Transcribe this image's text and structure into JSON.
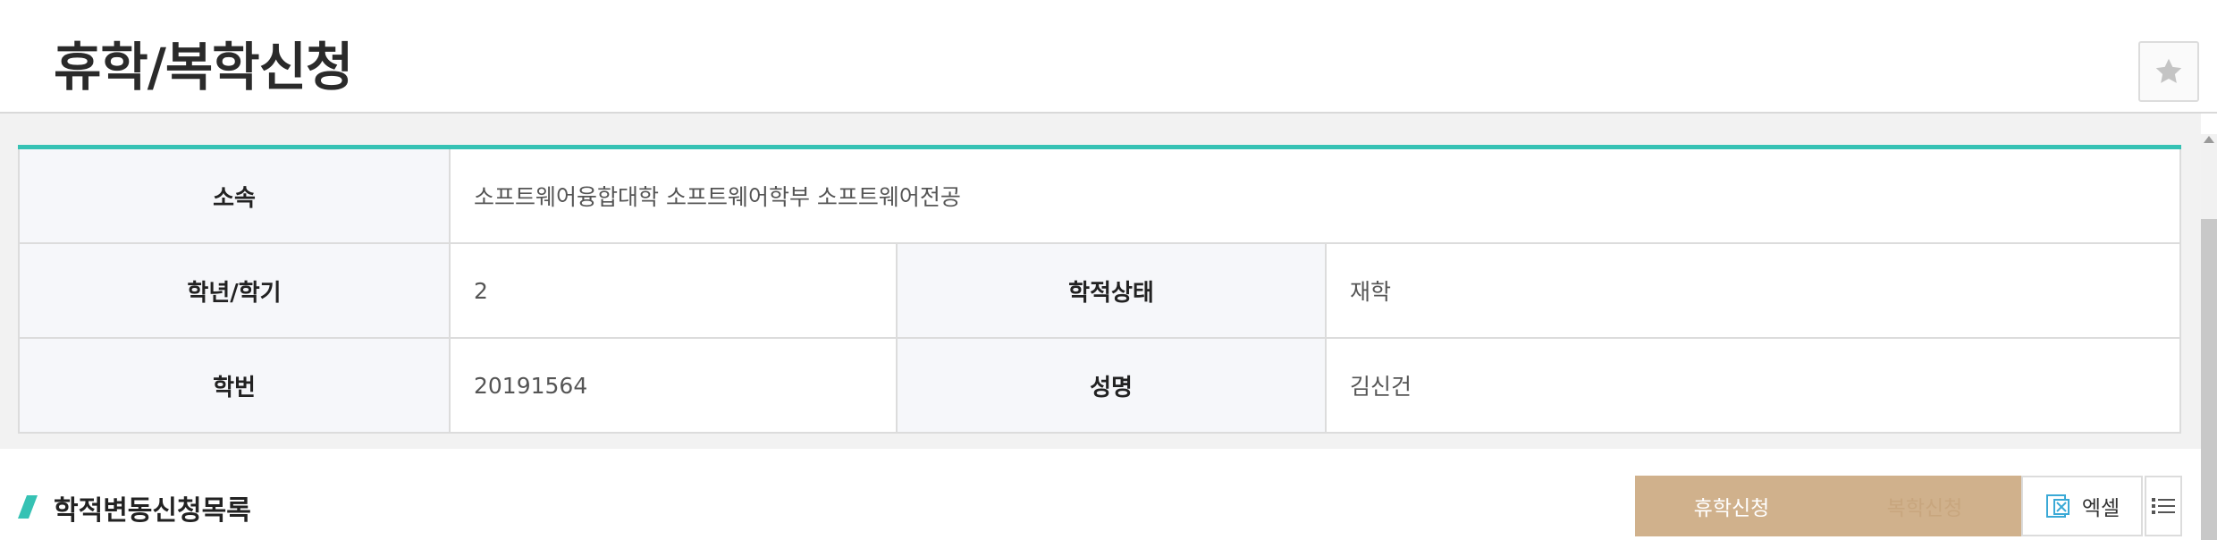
{
  "page": {
    "title": "휴학/복학신청"
  },
  "info": {
    "affiliation_label": "소속",
    "affiliation_value": "소프트웨어융합대학 소프트웨어학부 소프트웨어전공",
    "grade_label": "학년/학기",
    "grade_value": "2",
    "status_label": "학적상태",
    "status_value": "재학",
    "student_id_label": "학번",
    "student_id_value": "20191564",
    "name_label": "성명",
    "name_value": "김신건"
  },
  "section": {
    "title": "학적변동신청목록",
    "leave_button": "휴학신청",
    "return_button": "복학신청",
    "excel_button": "엑셀"
  },
  "colors": {
    "accent": "#36c2b4",
    "button": "#d0b18c"
  },
  "icons": {
    "favorite": "star-icon",
    "excel": "excel-icon",
    "list": "list-icon",
    "section": "slash-marker-icon"
  }
}
